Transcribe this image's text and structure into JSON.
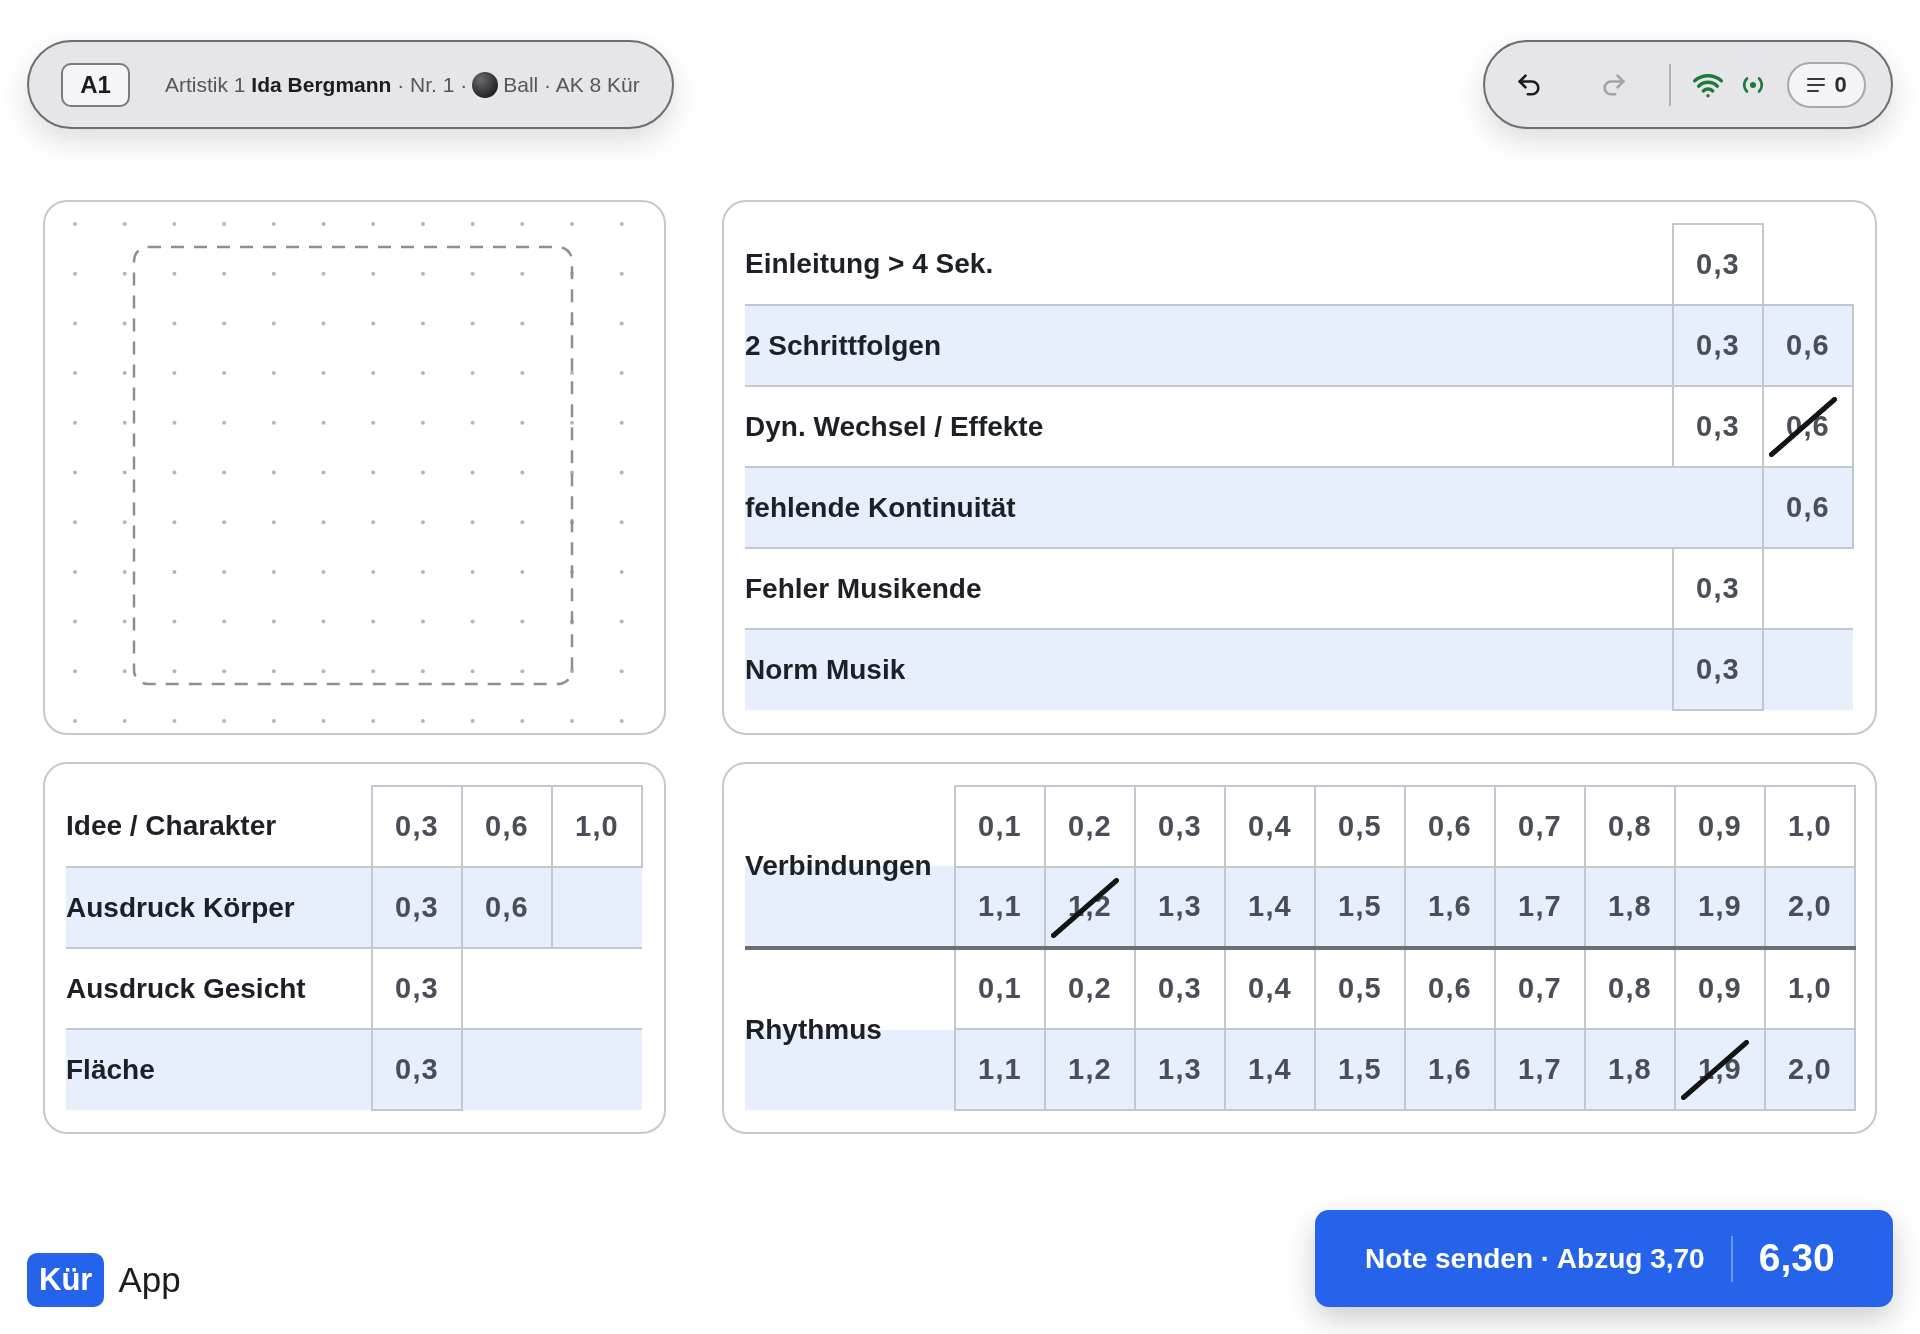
{
  "header": {
    "badge": "A1",
    "athlete": "Artistik 1 **Ida Bergmann** · Nr. 1 ·",
    "apparatus": "Ball · AK 8 Kür"
  },
  "toolbar": {
    "undo": {
      "disabled": false
    },
    "redo": {
      "disabled": true
    },
    "online": true,
    "queue_count": "0"
  },
  "music_deductions": {
    "rows": [
      {
        "label": "Einleitung > 4 Sek.",
        "cells": [
          {
            "value": "0,3",
            "selected": false
          },
          null
        ]
      },
      {
        "label": "2 Schrittfolgen",
        "cells": [
          {
            "value": "0,3",
            "selected": false
          },
          {
            "value": "0,6",
            "selected": false
          }
        ]
      },
      {
        "label": "Dyn. Wechsel / Effekte",
        "cells": [
          {
            "value": "0,3",
            "selected": false
          },
          {
            "value": "0,6",
            "selected": true
          }
        ]
      },
      {
        "label": "fehlende Kontinuität",
        "cells": [
          null,
          {
            "value": "0,6",
            "selected": false
          }
        ]
      },
      {
        "label": "Fehler Musikende",
        "cells": [
          {
            "value": "0,3",
            "selected": false
          },
          null
        ]
      },
      {
        "label": "Norm Musik",
        "cells": [
          {
            "value": "0,3",
            "selected": false
          },
          null
        ]
      }
    ]
  },
  "expression_deductions": {
    "rows": [
      {
        "label": "Idee / Charakter",
        "cells": [
          {
            "value": "0,3",
            "selected": false
          },
          {
            "value": "0,6",
            "selected": false
          },
          {
            "value": "1,0",
            "selected": false
          }
        ]
      },
      {
        "label": "Ausdruck Körper",
        "cells": [
          {
            "value": "0,3",
            "selected": false
          },
          {
            "value": "0,6",
            "selected": false
          },
          null
        ]
      },
      {
        "label": "Ausdruck Gesicht",
        "cells": [
          {
            "value": "0,3",
            "selected": false
          },
          null,
          null
        ]
      },
      {
        "label": "Fläche",
        "cells": [
          {
            "value": "0,3",
            "selected": false
          },
          null,
          null
        ]
      }
    ]
  },
  "connection_deductions": {
    "groups": [
      {
        "label": "Verbindungen",
        "rows": [
          {
            "cells": [
              {
                "value": "0,1",
                "selected": false
              },
              {
                "value": "0,2",
                "selected": false
              },
              {
                "value": "0,3",
                "selected": false
              },
              {
                "value": "0,4",
                "selected": false
              },
              {
                "value": "0,5",
                "selected": false
              },
              {
                "value": "0,6",
                "selected": false
              },
              {
                "value": "0,7",
                "selected": false
              },
              {
                "value": "0,8",
                "selected": false
              },
              {
                "value": "0,9",
                "selected": false
              },
              {
                "value": "1,0",
                "selected": false
              }
            ]
          },
          {
            "cells": [
              {
                "value": "1,1",
                "selected": false
              },
              {
                "value": "1,2",
                "selected": true
              },
              {
                "value": "1,3",
                "selected": false
              },
              {
                "value": "1,4",
                "selected": false
              },
              {
                "value": "1,5",
                "selected": false
              },
              {
                "value": "1,6",
                "selected": false
              },
              {
                "value": "1,7",
                "selected": false
              },
              {
                "value": "1,8",
                "selected": false
              },
              {
                "value": "1,9",
                "selected": false
              },
              {
                "value": "2,0",
                "selected": false
              }
            ]
          }
        ]
      },
      {
        "label": "Rhythmus",
        "rows": [
          {
            "cells": [
              {
                "value": "0,1",
                "selected": false
              },
              {
                "value": "0,2",
                "selected": false
              },
              {
                "value": "0,3",
                "selected": false
              },
              {
                "value": "0,4",
                "selected": false
              },
              {
                "value": "0,5",
                "selected": false
              },
              {
                "value": "0,6",
                "selected": false
              },
              {
                "value": "0,7",
                "selected": false
              },
              {
                "value": "0,8",
                "selected": false
              },
              {
                "value": "0,9",
                "selected": false
              },
              {
                "value": "1,0",
                "selected": false
              }
            ]
          },
          {
            "cells": [
              {
                "value": "1,1",
                "selected": false
              },
              {
                "value": "1,2",
                "selected": false
              },
              {
                "value": "1,3",
                "selected": false
              },
              {
                "value": "1,4",
                "selected": false
              },
              {
                "value": "1,5",
                "selected": false
              },
              {
                "value": "1,6",
                "selected": false
              },
              {
                "value": "1,7",
                "selected": false
              },
              {
                "value": "1,8",
                "selected": false
              },
              {
                "value": "1,9",
                "selected": true
              },
              {
                "value": "2,0",
                "selected": false
              }
            ]
          }
        ]
      }
    ]
  },
  "footer": {
    "logo_mark": "Kür",
    "logo_text": "App",
    "submit": {
      "label": "Note senden · Abzug 3,70",
      "score": "6,30"
    }
  }
}
